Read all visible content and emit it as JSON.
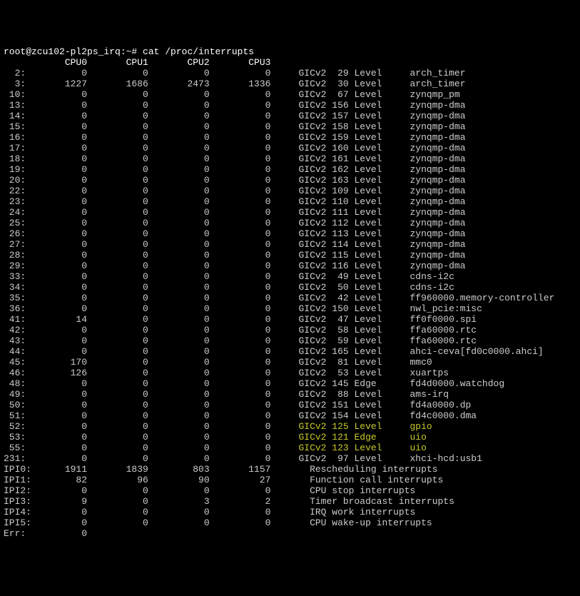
{
  "prompt": "root@zcu102-pl2ps_irq:~# cat /proc/interrupts",
  "header": [
    "CPU0",
    "CPU1",
    "CPU2",
    "CPU3"
  ],
  "rows": [
    {
      "id": "2:",
      "c": [
        0,
        0,
        0,
        0
      ],
      "ctrl": "GICv2",
      "num": "29",
      "t": "Level",
      "dev": "arch_timer"
    },
    {
      "id": "3:",
      "c": [
        1227,
        1686,
        2473,
        1336
      ],
      "ctrl": "GICv2",
      "num": "30",
      "t": "Level",
      "dev": "arch_timer"
    },
    {
      "id": "10:",
      "c": [
        0,
        0,
        0,
        0
      ],
      "ctrl": "GICv2",
      "num": "67",
      "t": "Level",
      "dev": "zynqmp_pm"
    },
    {
      "id": "13:",
      "c": [
        0,
        0,
        0,
        0
      ],
      "ctrl": "GICv2",
      "num": "156",
      "t": "Level",
      "dev": "zynqmp-dma"
    },
    {
      "id": "14:",
      "c": [
        0,
        0,
        0,
        0
      ],
      "ctrl": "GICv2",
      "num": "157",
      "t": "Level",
      "dev": "zynqmp-dma"
    },
    {
      "id": "15:",
      "c": [
        0,
        0,
        0,
        0
      ],
      "ctrl": "GICv2",
      "num": "158",
      "t": "Level",
      "dev": "zynqmp-dma"
    },
    {
      "id": "16:",
      "c": [
        0,
        0,
        0,
        0
      ],
      "ctrl": "GICv2",
      "num": "159",
      "t": "Level",
      "dev": "zynqmp-dma"
    },
    {
      "id": "17:",
      "c": [
        0,
        0,
        0,
        0
      ],
      "ctrl": "GICv2",
      "num": "160",
      "t": "Level",
      "dev": "zynqmp-dma"
    },
    {
      "id": "18:",
      "c": [
        0,
        0,
        0,
        0
      ],
      "ctrl": "GICv2",
      "num": "161",
      "t": "Level",
      "dev": "zynqmp-dma"
    },
    {
      "id": "19:",
      "c": [
        0,
        0,
        0,
        0
      ],
      "ctrl": "GICv2",
      "num": "162",
      "t": "Level",
      "dev": "zynqmp-dma"
    },
    {
      "id": "20:",
      "c": [
        0,
        0,
        0,
        0
      ],
      "ctrl": "GICv2",
      "num": "163",
      "t": "Level",
      "dev": "zynqmp-dma"
    },
    {
      "id": "22:",
      "c": [
        0,
        0,
        0,
        0
      ],
      "ctrl": "GICv2",
      "num": "109",
      "t": "Level",
      "dev": "zynqmp-dma"
    },
    {
      "id": "23:",
      "c": [
        0,
        0,
        0,
        0
      ],
      "ctrl": "GICv2",
      "num": "110",
      "t": "Level",
      "dev": "zynqmp-dma"
    },
    {
      "id": "24:",
      "c": [
        0,
        0,
        0,
        0
      ],
      "ctrl": "GICv2",
      "num": "111",
      "t": "Level",
      "dev": "zynqmp-dma"
    },
    {
      "id": "25:",
      "c": [
        0,
        0,
        0,
        0
      ],
      "ctrl": "GICv2",
      "num": "112",
      "t": "Level",
      "dev": "zynqmp-dma"
    },
    {
      "id": "26:",
      "c": [
        0,
        0,
        0,
        0
      ],
      "ctrl": "GICv2",
      "num": "113",
      "t": "Level",
      "dev": "zynqmp-dma"
    },
    {
      "id": "27:",
      "c": [
        0,
        0,
        0,
        0
      ],
      "ctrl": "GICv2",
      "num": "114",
      "t": "Level",
      "dev": "zynqmp-dma"
    },
    {
      "id": "28:",
      "c": [
        0,
        0,
        0,
        0
      ],
      "ctrl": "GICv2",
      "num": "115",
      "t": "Level",
      "dev": "zynqmp-dma"
    },
    {
      "id": "29:",
      "c": [
        0,
        0,
        0,
        0
      ],
      "ctrl": "GICv2",
      "num": "116",
      "t": "Level",
      "dev": "zynqmp-dma"
    },
    {
      "id": "33:",
      "c": [
        0,
        0,
        0,
        0
      ],
      "ctrl": "GICv2",
      "num": "49",
      "t": "Level",
      "dev": "cdns-i2c"
    },
    {
      "id": "34:",
      "c": [
        0,
        0,
        0,
        0
      ],
      "ctrl": "GICv2",
      "num": "50",
      "t": "Level",
      "dev": "cdns-i2c"
    },
    {
      "id": "35:",
      "c": [
        0,
        0,
        0,
        0
      ],
      "ctrl": "GICv2",
      "num": "42",
      "t": "Level",
      "dev": "ff960000.memory-controller"
    },
    {
      "id": "36:",
      "c": [
        0,
        0,
        0,
        0
      ],
      "ctrl": "GICv2",
      "num": "150",
      "t": "Level",
      "dev": "nwl_pcie:misc"
    },
    {
      "id": "41:",
      "c": [
        14,
        0,
        0,
        0
      ],
      "ctrl": "GICv2",
      "num": "47",
      "t": "Level",
      "dev": "ff0f0000.spi"
    },
    {
      "id": "42:",
      "c": [
        0,
        0,
        0,
        0
      ],
      "ctrl": "GICv2",
      "num": "58",
      "t": "Level",
      "dev": "ffa60000.rtc"
    },
    {
      "id": "43:",
      "c": [
        0,
        0,
        0,
        0
      ],
      "ctrl": "GICv2",
      "num": "59",
      "t": "Level",
      "dev": "ffa60000.rtc"
    },
    {
      "id": "44:",
      "c": [
        0,
        0,
        0,
        0
      ],
      "ctrl": "GICv2",
      "num": "165",
      "t": "Level",
      "dev": "ahci-ceva[fd0c0000.ahci]"
    },
    {
      "id": "45:",
      "c": [
        170,
        0,
        0,
        0
      ],
      "ctrl": "GICv2",
      "num": "81",
      "t": "Level",
      "dev": "mmc0"
    },
    {
      "id": "46:",
      "c": [
        126,
        0,
        0,
        0
      ],
      "ctrl": "GICv2",
      "num": "53",
      "t": "Level",
      "dev": "xuartps"
    },
    {
      "id": "48:",
      "c": [
        0,
        0,
        0,
        0
      ],
      "ctrl": "GICv2",
      "num": "145",
      "t": "Edge ",
      "dev": "fd4d0000.watchdog"
    },
    {
      "id": "49:",
      "c": [
        0,
        0,
        0,
        0
      ],
      "ctrl": "GICv2",
      "num": "88",
      "t": "Level",
      "dev": "ams-irq"
    },
    {
      "id": "50:",
      "c": [
        0,
        0,
        0,
        0
      ],
      "ctrl": "GICv2",
      "num": "151",
      "t": "Level",
      "dev": "fd4a0000.dp"
    },
    {
      "id": "51:",
      "c": [
        0,
        0,
        0,
        0
      ],
      "ctrl": "GICv2",
      "num": "154",
      "t": "Level",
      "dev": "fd4c0000.dma"
    },
    {
      "id": "52:",
      "c": [
        0,
        0,
        0,
        0
      ],
      "ctrl": "GICv2",
      "num": "125",
      "t": "Level",
      "dev": "gpio",
      "hl": true
    },
    {
      "id": "53:",
      "c": [
        0,
        0,
        0,
        0
      ],
      "ctrl": "GICv2",
      "num": "121",
      "t": "Edge ",
      "dev": "uio",
      "hl": true
    },
    {
      "id": "55:",
      "c": [
        0,
        0,
        0,
        0
      ],
      "ctrl": "GICv2",
      "num": "123",
      "t": "Level",
      "dev": "uio",
      "hl": true
    },
    {
      "id": "231:",
      "c": [
        0,
        0,
        0,
        0
      ],
      "ctrl": "GICv2",
      "num": "97",
      "t": "Level",
      "dev": "xhci-hcd:usb1"
    }
  ],
  "ipi": [
    {
      "id": "IPI0:",
      "c": [
        1911,
        1839,
        803,
        1157
      ],
      "desc": "Rescheduling interrupts"
    },
    {
      "id": "IPI1:",
      "c": [
        82,
        96,
        90,
        27
      ],
      "desc": "Function call interrupts"
    },
    {
      "id": "IPI2:",
      "c": [
        0,
        0,
        0,
        0
      ],
      "desc": "CPU stop interrupts"
    },
    {
      "id": "IPI3:",
      "c": [
        9,
        0,
        3,
        2
      ],
      "desc": "Timer broadcast interrupts"
    },
    {
      "id": "IPI4:",
      "c": [
        0,
        0,
        0,
        0
      ],
      "desc": "IRQ work interrupts"
    },
    {
      "id": "IPI5:",
      "c": [
        0,
        0,
        0,
        0
      ],
      "desc": "CPU wake-up interrupts"
    }
  ],
  "err": {
    "id": "Err:",
    "c": [
      0
    ]
  }
}
